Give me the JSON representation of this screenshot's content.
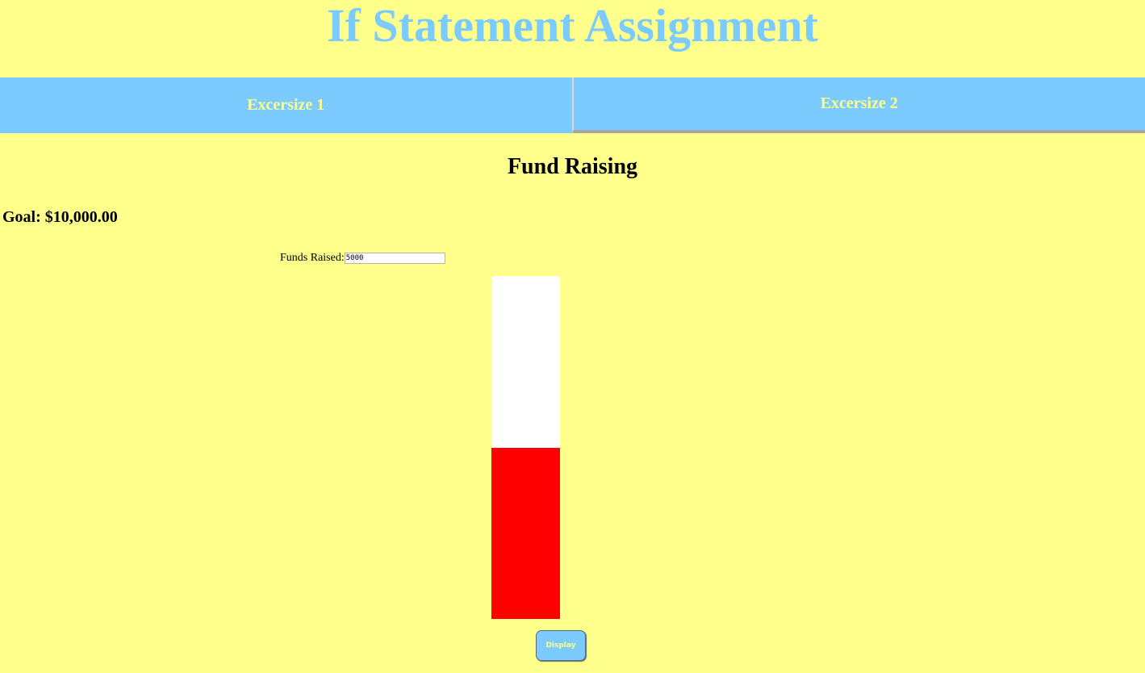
{
  "page": {
    "title": "If Statement Assignment"
  },
  "tabs": [
    {
      "label": "Excersize 1"
    },
    {
      "label": "Excersize 2"
    }
  ],
  "section": {
    "title": "Fund Raising",
    "goal_text": "Goal: $10,000.00"
  },
  "funds": {
    "label": "Funds Raised:",
    "value": "5000"
  },
  "thermometer": {
    "goal": 10000,
    "raised": 5000,
    "fill_fraction": 0.5
  },
  "display_button": {
    "label": "Display"
  },
  "colors": {
    "background": "#ffff8c",
    "accent_blue": "#7bcbff",
    "fill_red": "#ff0000",
    "empty_white": "#ffffff"
  }
}
